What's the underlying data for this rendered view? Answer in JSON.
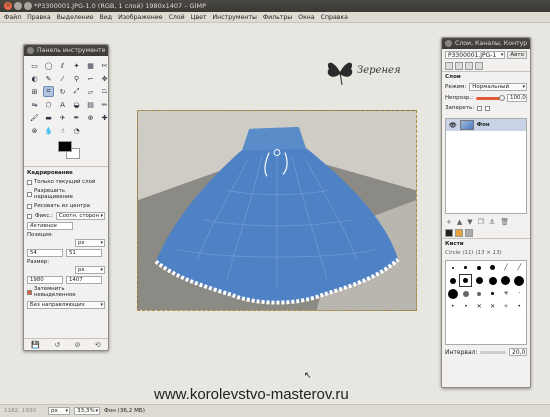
{
  "window": {
    "title": "*P3300001.JPG-1.0 (RGB, 1 слой) 1980x1407 – GIMP"
  },
  "menu": [
    "Файл",
    "Правка",
    "Выделение",
    "Вид",
    "Изображение",
    "Слой",
    "Цвет",
    "Инструменты",
    "Фильтры",
    "Окна",
    "Справка"
  ],
  "toolbox": {
    "title": "Панель инструменте",
    "tool_icons": [
      "rect-select",
      "ellipse-select",
      "free-select",
      "fuzzy-select",
      "color-select",
      "scissors",
      "foreground-select",
      "paths",
      "color-picker",
      "zoom",
      "measure",
      "move",
      "align",
      "crop",
      "rotate",
      "scale",
      "shear",
      "perspective",
      "flip",
      "cage",
      "text",
      "bucket-fill",
      "blend",
      "pencil",
      "paintbrush",
      "eraser",
      "airbrush",
      "ink",
      "clone",
      "heal",
      "perspective-clone",
      "blur",
      "smudge",
      "dodge"
    ],
    "options": {
      "title": "Кадрирование",
      "current_layer_only": "Только текущий слой",
      "allow_growing": "Разрешить наращивание",
      "expand_from_center": "Рисовать из центра",
      "fixed_label": "Фикс.:",
      "fixed_combo": "Соотн. сторон",
      "fixed_value": "Активное",
      "position_label": "Позиция:",
      "position_unit": "px",
      "position_x": "54",
      "position_y": "51",
      "size_label": "Размер:",
      "size_unit": "px",
      "size_w": "1980",
      "size_h": "1407",
      "highlight": "Затемнить невыделенное",
      "guides": "Без направляющих"
    }
  },
  "layers_dock": {
    "title": "Слои, Каналы, Контур",
    "image_combo": "P3300001.JPG-1",
    "auto_button": "Авто",
    "section": "Слои",
    "mode_label": "Режим:",
    "mode_value": "Нормальный",
    "opacity_label": "Непрозр.:",
    "opacity_value": "100,0",
    "lock_label": "Запереть:",
    "layer_name": "Фон",
    "brushes_title": "Кисти",
    "brush_name": "Circle (11) (13 × 13)",
    "spacing_label": "Интервал:",
    "spacing_value": "20,0"
  },
  "watermark": {
    "logo_text": "Зеренея"
  },
  "website": "www.korolevstvo-masterov.ru",
  "status": {
    "coords": "1182, 1930",
    "unit": "px",
    "zoom": "33,3%",
    "info": "Фон (36,2 МБ)"
  },
  "colors": {
    "accent": "#e05a3c",
    "titlebar": "#3c3b37",
    "skirt": "#4f82c4"
  }
}
